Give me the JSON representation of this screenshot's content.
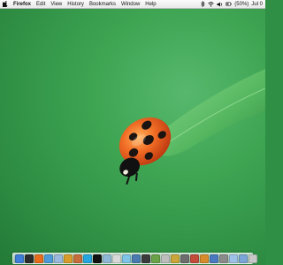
{
  "menubar": {
    "apple_icon": "apple-logo",
    "items": [
      {
        "label": "Firefox",
        "name": "menu-firefox",
        "app": true
      },
      {
        "label": "Edit",
        "name": "menu-edit"
      },
      {
        "label": "View",
        "name": "menu-view"
      },
      {
        "label": "History",
        "name": "menu-history"
      },
      {
        "label": "Bookmarks",
        "name": "menu-bookmarks"
      },
      {
        "label": "Window",
        "name": "menu-window"
      },
      {
        "label": "Help",
        "name": "menu-help"
      }
    ],
    "status": {
      "battery_percent": "(50%)",
      "clock": "Jul 0"
    }
  },
  "dock": {
    "icons": [
      {
        "name": "finder-icon",
        "color": "#3f7ed8"
      },
      {
        "name": "dashboard-icon",
        "color": "#2b2b2b"
      },
      {
        "name": "firefox-icon",
        "color": "#e96c1a"
      },
      {
        "name": "safari-icon",
        "color": "#4c9ad8"
      },
      {
        "name": "mail-icon",
        "color": "#9bb8dd"
      },
      {
        "name": "ichat-icon",
        "color": "#d89c2a"
      },
      {
        "name": "address-book-icon",
        "color": "#c66d3c"
      },
      {
        "name": "skype-icon",
        "color": "#25a6df"
      },
      {
        "name": "terminal-icon",
        "color": "#111111"
      },
      {
        "name": "preview-icon",
        "color": "#8fb7d6"
      },
      {
        "name": "ical-icon",
        "color": "#d9d9d9"
      },
      {
        "name": "itunes-icon",
        "color": "#7fc3e6"
      },
      {
        "name": "photo-icon",
        "color": "#4a7ab0"
      },
      {
        "name": "app-icon-12",
        "color": "#3b3b3b"
      },
      {
        "name": "app-icon-13",
        "color": "#6aa248"
      },
      {
        "name": "app-icon-14",
        "color": "#bdbdbd"
      },
      {
        "name": "app-icon-15",
        "color": "#c9a53a"
      },
      {
        "name": "app-icon-16",
        "color": "#6d6d6d"
      },
      {
        "name": "app-icon-17",
        "color": "#c24b3a"
      },
      {
        "name": "app-icon-18",
        "color": "#d88b2a"
      },
      {
        "name": "app-icon-19",
        "color": "#4b79c0"
      },
      {
        "name": "system-preferences-icon",
        "color": "#8b8b8b"
      },
      {
        "name": "documents-folder-icon",
        "color": "#9ec1e8"
      },
      {
        "name": "downloads-folder-icon",
        "color": "#7aa5d6"
      },
      {
        "name": "trash-icon",
        "color": "#c8c8c8"
      }
    ]
  }
}
